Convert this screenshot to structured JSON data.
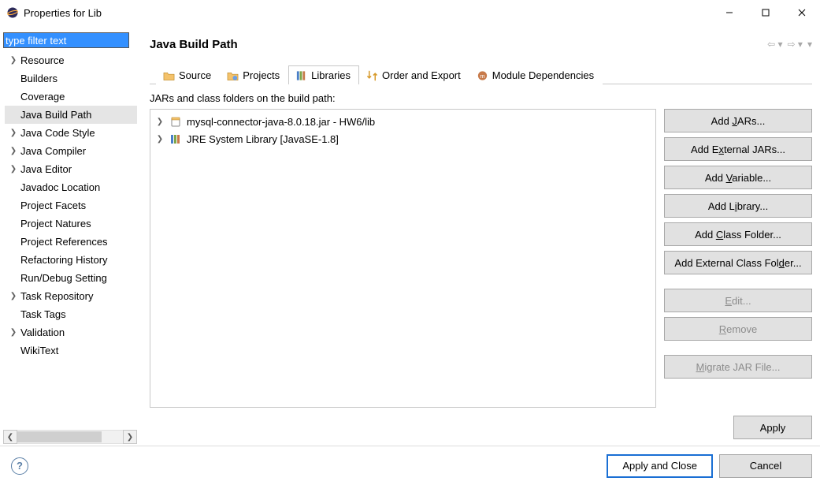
{
  "window": {
    "title": "Properties for Lib"
  },
  "sidebar": {
    "filter_placeholder": "type filter text",
    "items": [
      {
        "label": "Resource",
        "expandable": true
      },
      {
        "label": "Builders",
        "expandable": false
      },
      {
        "label": "Coverage",
        "expandable": false
      },
      {
        "label": "Java Build Path",
        "expandable": false,
        "selected": true
      },
      {
        "label": "Java Code Style",
        "expandable": true
      },
      {
        "label": "Java Compiler",
        "expandable": true
      },
      {
        "label": "Java Editor",
        "expandable": true
      },
      {
        "label": "Javadoc Location",
        "expandable": false
      },
      {
        "label": "Project Facets",
        "expandable": false
      },
      {
        "label": "Project Natures",
        "expandable": false
      },
      {
        "label": "Project References",
        "expandable": false
      },
      {
        "label": "Refactoring History",
        "expandable": false
      },
      {
        "label": "Run/Debug Setting",
        "expandable": false
      },
      {
        "label": "Task Repository",
        "expandable": true
      },
      {
        "label": "Task Tags",
        "expandable": false
      },
      {
        "label": "Validation",
        "expandable": true
      },
      {
        "label": "WikiText",
        "expandable": false
      }
    ]
  },
  "content": {
    "title": "Java Build Path",
    "tabs": [
      {
        "id": "source",
        "label": "Source",
        "icon": "source-folder-icon"
      },
      {
        "id": "projects",
        "label": "Projects",
        "icon": "projects-icon"
      },
      {
        "id": "libraries",
        "label": "Libraries",
        "icon": "library-icon",
        "active": true
      },
      {
        "id": "order",
        "label": "Order and Export",
        "icon": "order-icon"
      },
      {
        "id": "modules",
        "label": "Module Dependencies",
        "icon": "module-icon"
      }
    ],
    "caption": "JARs and class folders on the build path:",
    "lib_items": [
      {
        "label": "mysql-connector-java-8.0.18.jar - HW6/lib",
        "icon": "jar-icon"
      },
      {
        "label": "JRE System Library [JavaSE-1.8]",
        "icon": "library-stack-icon"
      }
    ],
    "actions": {
      "add_jars": {
        "pre": "Add ",
        "u": "J",
        "post": "ARs..."
      },
      "add_ext_jars": {
        "pre": "Add E",
        "u": "x",
        "post": "ternal JARs..."
      },
      "add_variable": {
        "pre": "Add ",
        "u": "V",
        "post": "ariable..."
      },
      "add_library": {
        "pre": "Add L",
        "u": "i",
        "post": "brary..."
      },
      "add_class_folder": {
        "pre": "Add ",
        "u": "C",
        "post": "lass Folder..."
      },
      "add_ext_class_folder": {
        "pre": "Add External Class Fol",
        "u": "d",
        "post": "er..."
      },
      "edit": {
        "pre": "",
        "u": "E",
        "post": "dit..."
      },
      "remove": {
        "pre": "",
        "u": "R",
        "post": "emove"
      },
      "migrate": {
        "pre": "",
        "u": "M",
        "post": "igrate JAR File..."
      }
    },
    "apply": "Apply"
  },
  "footer": {
    "apply_close": "Apply and Close",
    "cancel": "Cancel"
  }
}
